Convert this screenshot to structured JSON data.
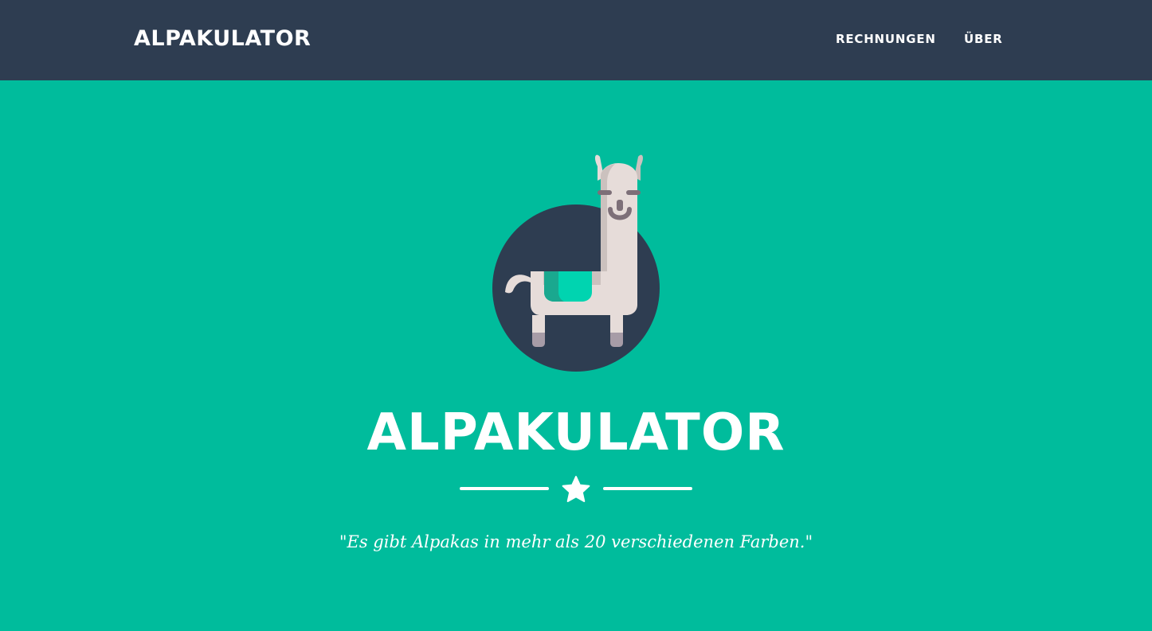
{
  "navbar": {
    "brand": "ALPAKULATOR",
    "links": [
      {
        "label": "RECHNUNGEN"
      },
      {
        "label": "ÜBER"
      }
    ]
  },
  "hero": {
    "title": "ALPAKULATOR",
    "quote": "\"Es gibt Alpakas in mehr als 20 verschiedenen Farben.\"",
    "avatar_icon": "llama-icon",
    "divider_icon": "star-icon"
  },
  "colors": {
    "navbar_bg": "#2e3d51",
    "hero_bg": "#00bc9c",
    "text": "#ffffff",
    "avatar_circle": "#2e3d51",
    "llama_body": "#e6dcd9",
    "llama_shade": "#cbc1be",
    "saddle": "#00d4b0",
    "saddle_shade": "#1aa88f",
    "hooves": "#a79ca7",
    "face": "#7d6f78"
  }
}
